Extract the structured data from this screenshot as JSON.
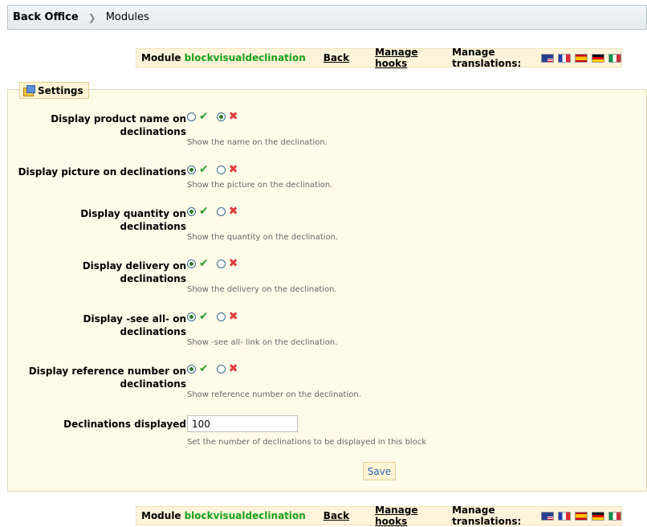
{
  "breadcrumb": {
    "root": "Back Office",
    "current": "Modules"
  },
  "module_bar": {
    "module_label": "Module",
    "module_name": "blockvisualdeclination",
    "back_label": "Back",
    "hooks_label": "Manage hooks",
    "translations_label": "Manage translations:",
    "flags": [
      "en",
      "fr",
      "es",
      "de",
      "it"
    ]
  },
  "settings": {
    "legend": "Settings",
    "fields": [
      {
        "label": "Display product name on declinations",
        "hint": "Show the name on the declination.",
        "value": "no"
      },
      {
        "label": "Display picture on declinations",
        "hint": "Show the picture on the declination.",
        "value": "yes"
      },
      {
        "label": "Display quantity on declinations",
        "hint": "Show the quantity on the declination.",
        "value": "yes"
      },
      {
        "label": "Display delivery on declinations",
        "hint": "Show the delivery on the declination.",
        "value": "yes"
      },
      {
        "label": "Display -see all- on declinations",
        "hint": "Show -see all- link on the declination.",
        "value": "yes"
      },
      {
        "label": "Display reference number on declinations",
        "hint": "Show reference number on the declination.",
        "value": "yes"
      }
    ],
    "declinations": {
      "label": "Declinations displayed",
      "value": "100",
      "hint": "Set the number of declinations to be displayed in this block"
    },
    "save_label": "Save"
  },
  "colors": {
    "module_name": "#16a11a",
    "yes": "#2f9e2f",
    "no": "#e23b3b",
    "save": "#2d63b5"
  }
}
